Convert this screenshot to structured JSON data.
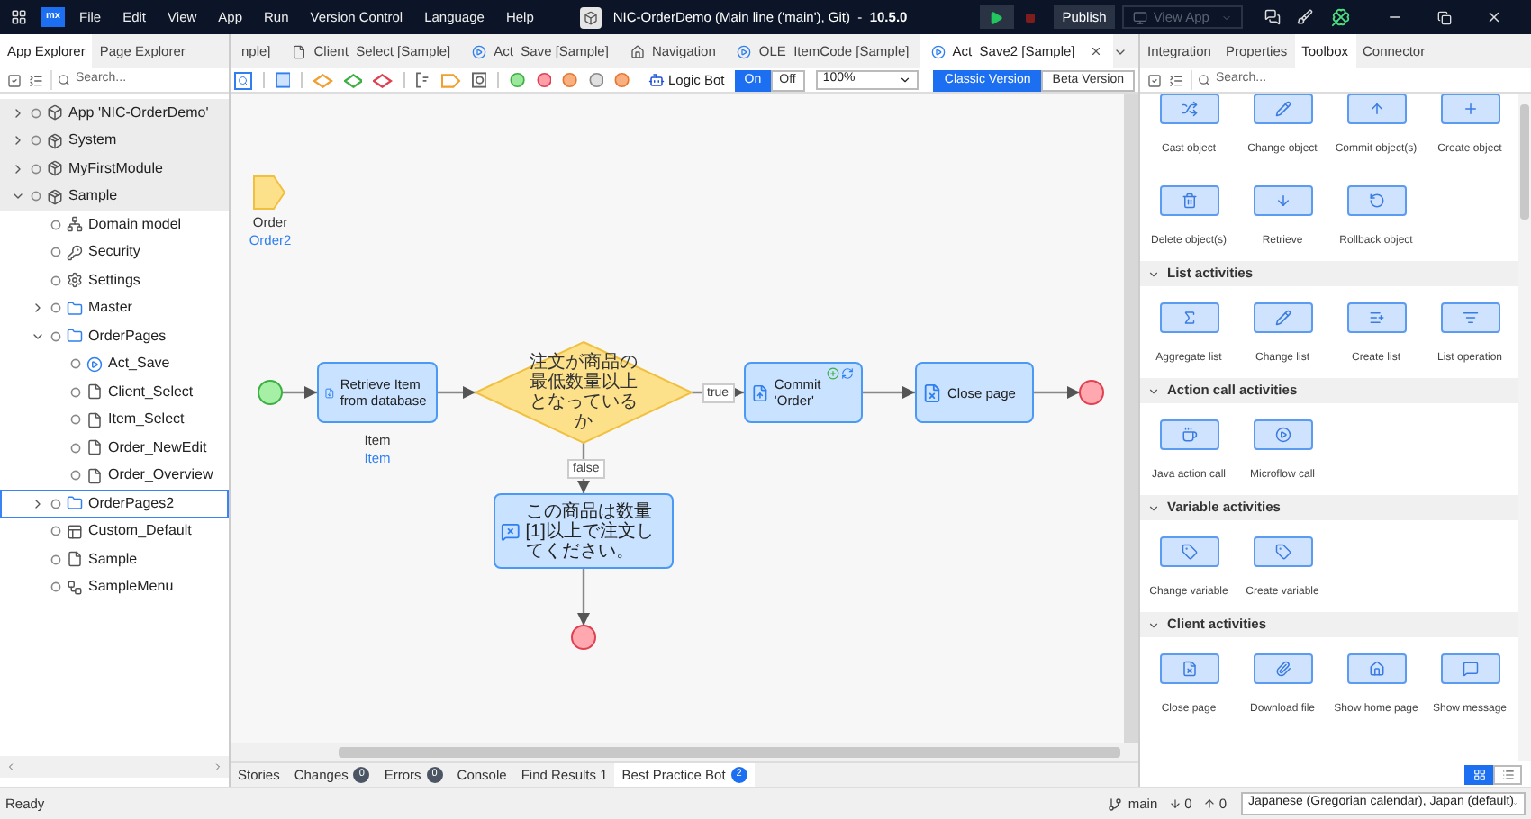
{
  "title_bar": {
    "logo": "mx",
    "menu": [
      "File",
      "Edit",
      "View",
      "App",
      "Run",
      "Version Control",
      "Language",
      "Help"
    ],
    "title": "NIC-OrderDemo (Main line ('main'), Git)  -  **10.5.0**",
    "publish": "Publish",
    "view_app": "View App"
  },
  "left_panel": {
    "tabs": [
      {
        "label": "App Explorer",
        "selected": true
      },
      {
        "label": "Page Explorer",
        "selected": false
      }
    ],
    "search": {
      "placeholder": "Search..."
    },
    "tree": [
      {
        "label": "App 'NIC-OrderDemo'",
        "kind": "app",
        "expanded": false,
        "selected": false
      },
      {
        "label": "System",
        "kind": "module",
        "expanded": false,
        "selected": false
      },
      {
        "label": "MyFirstModule",
        "kind": "module",
        "expanded": false,
        "selected": false
      },
      {
        "label": "Sample",
        "kind": "module",
        "expanded": true,
        "selected": false,
        "children": [
          {
            "label": "Domain model",
            "kind": "domain",
            "selected": false
          },
          {
            "label": "Security",
            "kind": "security",
            "selected": false
          },
          {
            "label": "Settings",
            "kind": "settings",
            "selected": false
          },
          {
            "label": "Master",
            "kind": "folder",
            "expanded": false,
            "selected": false
          },
          {
            "label": "OrderPages",
            "kind": "folder",
            "expanded": true,
            "selected": false,
            "children": [
              {
                "label": "Act_Save",
                "kind": "microflow",
                "selected": false
              },
              {
                "label": "Client_Select",
                "kind": "page",
                "selected": false
              },
              {
                "label": "Item_Select",
                "kind": "page",
                "selected": false
              },
              {
                "label": "Order_NewEdit",
                "kind": "page",
                "selected": false
              },
              {
                "label": "Order_Overview",
                "kind": "page",
                "selected": false
              }
            ]
          },
          {
            "label": "OrderPages2",
            "kind": "folder",
            "expanded": false,
            "selected": true
          },
          {
            "label": "Custom_Default",
            "kind": "layout",
            "selected": false
          },
          {
            "label": "Sample",
            "kind": "page",
            "selected": false
          },
          {
            "label": "SampleMenu",
            "kind": "menu",
            "selected": false
          }
        ]
      }
    ]
  },
  "editor": {
    "tabs": [
      {
        "label": "nple]",
        "kind": "cut",
        "selected": false
      },
      {
        "label": "Client_Select [Sample]",
        "kind": "page",
        "selected": false
      },
      {
        "label": "Act_Save [Sample]",
        "kind": "microflow",
        "selected": false
      },
      {
        "label": "Navigation",
        "kind": "navigation",
        "selected": false
      },
      {
        "label": "OLE_ItemCode [Sample]",
        "kind": "microflow",
        "selected": false
      },
      {
        "label": "Act_Save2 [Sample]",
        "kind": "microflow",
        "selected": true
      }
    ],
    "toolbar": {
      "logic_bot": "Logic Bot",
      "toggle": [
        {
          "label": "On",
          "selected": true
        },
        {
          "label": "Off",
          "selected": false
        }
      ],
      "zoom": "100%",
      "versions": [
        {
          "label": "Classic Version",
          "selected": true
        },
        {
          "label": "Beta Version",
          "selected": false
        }
      ]
    },
    "canvas": {
      "parameter": {
        "name": "Order",
        "type": "Order2"
      },
      "nodes": [
        {
          "kind": "start"
        },
        {
          "kind": "retrieve",
          "text": "Retrieve Item from database",
          "output": {
            "name": "Item",
            "type": "Item"
          }
        },
        {
          "kind": "decision",
          "text": "注文が商品の最低数量以上となっているか",
          "branches": [
            "true",
            "false"
          ]
        },
        {
          "kind": "commit",
          "text": "Commit 'Order'"
        },
        {
          "kind": "close",
          "text": "Close page"
        },
        {
          "kind": "end"
        },
        {
          "kind": "message",
          "text": "この商品は数量[1]以上で注文してください。"
        },
        {
          "kind": "end"
        }
      ]
    },
    "bottom_tabs": [
      {
        "label": "Stories",
        "selected": false
      },
      {
        "label": "Changes",
        "badge": "0",
        "color": "#4b5563",
        "selected": false
      },
      {
        "label": "Errors",
        "badge": "0",
        "color": "#4b5563",
        "selected": false
      },
      {
        "label": "Console",
        "selected": false
      },
      {
        "label": "Find Results 1",
        "selected": false
      },
      {
        "label": "Best Practice Bot",
        "badge": "2",
        "color": "#1d6ff2",
        "selected": true
      }
    ]
  },
  "right_panel": {
    "tabs": [
      {
        "label": "Integration",
        "selected": false
      },
      {
        "label": "Properties",
        "selected": false
      },
      {
        "label": "Toolbox",
        "selected": true
      },
      {
        "label": "Connector",
        "selected": false
      }
    ],
    "search": {
      "placeholder": "Search..."
    },
    "sections": [
      {
        "items": [
          {
            "label": "Cast object",
            "kind": "cast"
          },
          {
            "label": "Change object",
            "kind": "change"
          },
          {
            "label": "Commit object(s)",
            "kind": "commit"
          },
          {
            "label": "Create object",
            "kind": "create"
          },
          {
            "label": "Delete object(s)",
            "kind": "delete"
          },
          {
            "label": "Retrieve",
            "kind": "retrieve"
          },
          {
            "label": "Rollback object",
            "kind": "rollback"
          }
        ]
      },
      {
        "title": "List activities",
        "expanded": true,
        "items": [
          {
            "label": "Aggregate list",
            "kind": "aggregate"
          },
          {
            "label": "Change list",
            "kind": "change"
          },
          {
            "label": "Create list",
            "kind": "list_create"
          },
          {
            "label": "List operation",
            "kind": "list_op"
          }
        ]
      },
      {
        "title": "Action call activities",
        "expanded": true,
        "items": [
          {
            "label": "Java action call",
            "kind": "java"
          },
          {
            "label": "Microflow call",
            "kind": "microflow"
          }
        ]
      },
      {
        "title": "Variable activities",
        "expanded": true,
        "items": [
          {
            "label": "Change variable",
            "kind": "var_change"
          },
          {
            "label": "Create variable",
            "kind": "var_create"
          }
        ]
      },
      {
        "title": "Client activities",
        "expanded": true,
        "items": [
          {
            "label": "Close page",
            "kind": "close"
          },
          {
            "label": "Download file",
            "kind": "download"
          },
          {
            "label": "Show home page",
            "kind": "home"
          },
          {
            "label": "Show message",
            "kind": "message"
          }
        ]
      }
    ],
    "views": [
      {
        "kind": "grid",
        "selected": true
      },
      {
        "kind": "list",
        "selected": false
      }
    ]
  },
  "status_bar": {
    "text": "Ready",
    "branch": "main",
    "incoming": "0",
    "outgoing": "0",
    "language": "Japanese (Gregorian calendar), Japan (default)"
  }
}
